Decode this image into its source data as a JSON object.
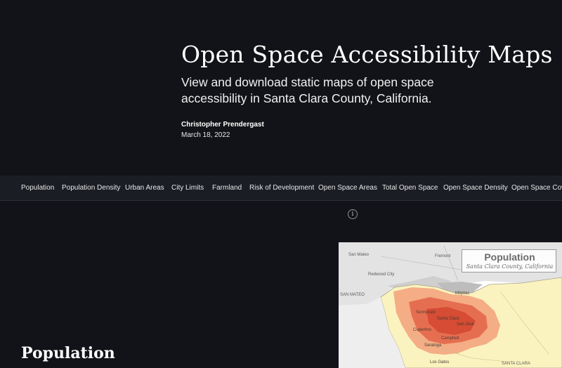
{
  "hero": {
    "title": "Open Space Accessibility Maps",
    "subtitle": "View and download static maps of open space accessibility in Santa Clara County, California.",
    "author": "Christopher Prendergast",
    "date": "March 18, 2022"
  },
  "nav": {
    "items": [
      {
        "label": "Population"
      },
      {
        "label": "Population Density"
      },
      {
        "label": "Urban Areas"
      },
      {
        "label": "City Limits"
      },
      {
        "label": "Farmland"
      },
      {
        "label": "Risk of Development"
      },
      {
        "label": "Open Space Areas"
      },
      {
        "label": "Total Open Space"
      },
      {
        "label": "Open Space Density"
      },
      {
        "label": "Open Space Cove"
      }
    ]
  },
  "info": {
    "icon": "info-icon",
    "glyph": "i"
  },
  "section": {
    "title": "Population"
  },
  "map": {
    "legend_title": "Population",
    "legend_subtitle": "Santa Clara County, California",
    "labels": {
      "san_mateo": "San Mateo",
      "fremont": "Fremont",
      "redwood_city": "Redwood City",
      "san_mateo_county": "SAN MATEO",
      "milpitas": "Milpitas",
      "sunnyvale": "Sunnyvale",
      "santa_clara": "Santa Clara",
      "san_jose": "San Jose",
      "cupertino": "Cupertino",
      "campbell": "Campbell",
      "saratoga": "Saratoga",
      "los_gatos": "Los Gatos",
      "santa_clara_county": "SANTA CLARA"
    }
  },
  "colors": {
    "background": "#121318",
    "navbar": "#1b1d24",
    "map_land": "#fbf3bf",
    "map_water": "#d9d9d9",
    "map_population": "#e4674a"
  }
}
